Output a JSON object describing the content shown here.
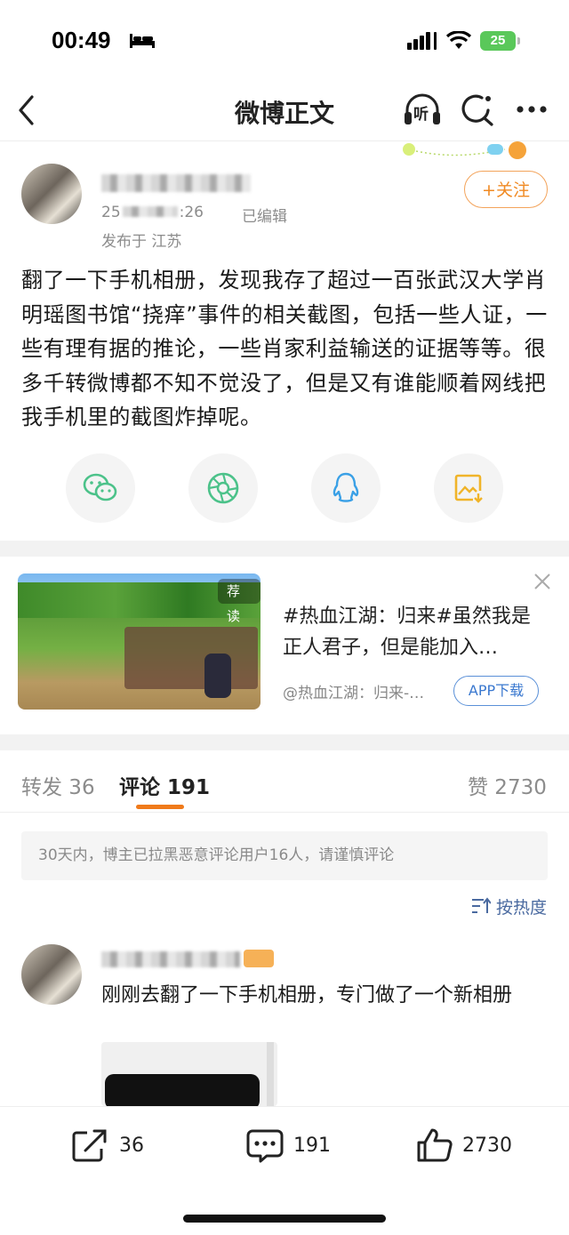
{
  "status_bar": {
    "time": "00:49",
    "battery": "25"
  },
  "nav": {
    "title": "微博正文",
    "listen_label": "听"
  },
  "post": {
    "time_visible_start": "25",
    "time_visible_end": ":26",
    "edited": "已编辑",
    "location": "发布于 江苏",
    "follow_label": "+关注",
    "text": "翻了一下手机相册，发现我存了超过一百张武汉大学肖明瑶图书馆“挠痒”事件的相关截图，包括一些人证，一些有理有据的推论，一些肖家利益输送的证据等等。很多千转微博都不知不觉没了，但是又有谁能顺着网线把我手机里的截图炸掉呢。"
  },
  "ad": {
    "badge": "荐读",
    "title": "#热血江湖：归来#虽然我是正人君子，但是能加入…",
    "source": "@热血江湖：归来-…",
    "button": "APP下载"
  },
  "tabs": {
    "repost": "转发 36",
    "comments": "评论 191",
    "likes": "赞 2730"
  },
  "notice": "30天内，博主已拉黑恶意评论用户16人，请谨慎评论",
  "sort_label": "按热度",
  "comment": {
    "text": "刚刚去翻了一下手机相册，专门做了一个新相册"
  },
  "bottom_bar": {
    "repost_count": "36",
    "comment_count": "191",
    "like_count": "2730"
  },
  "colors": {
    "accent_orange": "#f08a23",
    "link_blue": "#3a78cf",
    "wechat_green": "#4cc28a",
    "qq_blue": "#3aa0e6",
    "album_orange": "#f0b429"
  }
}
